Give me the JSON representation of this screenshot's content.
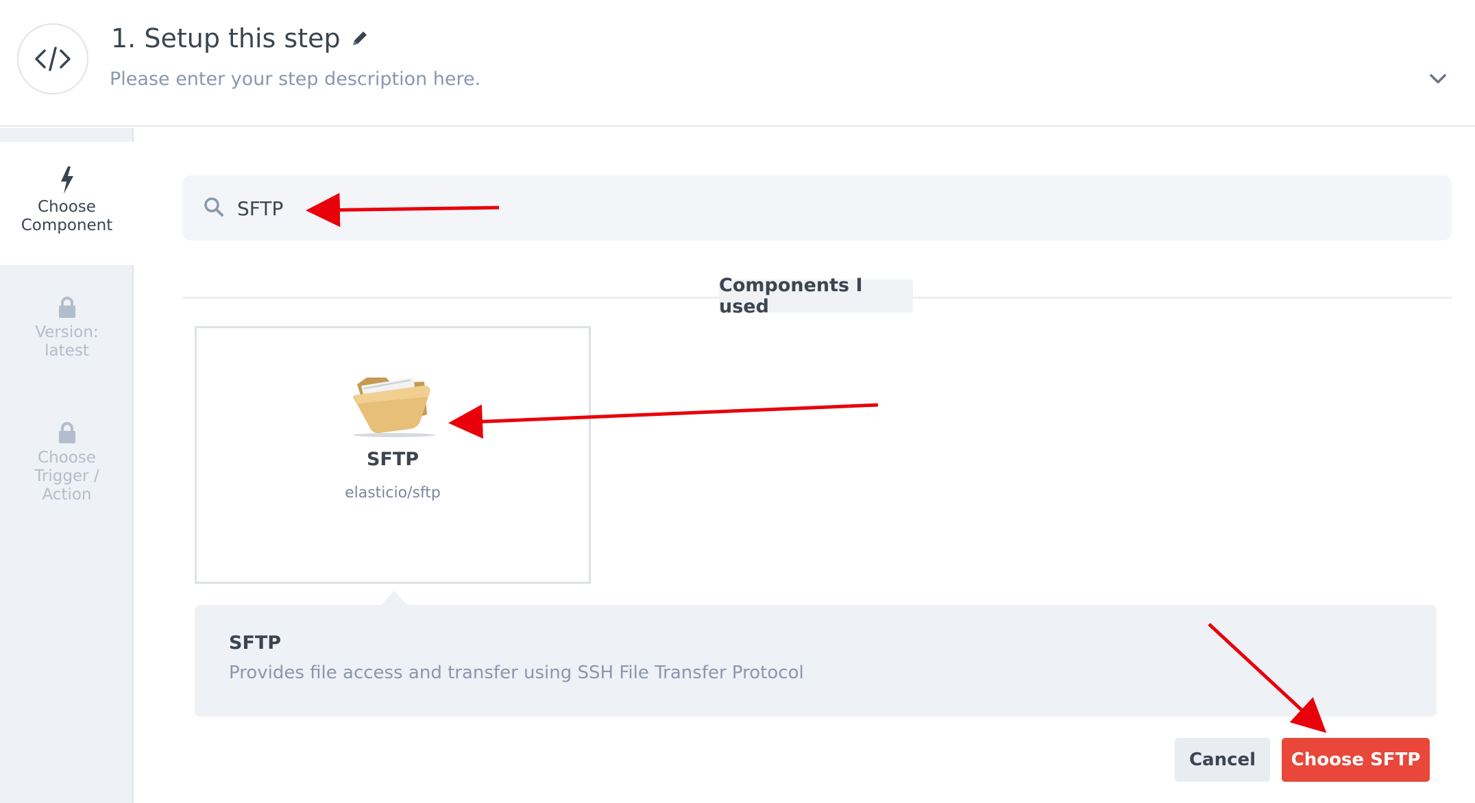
{
  "header": {
    "title": "1. Setup this step",
    "description": "Please enter your step description here.",
    "step_icon": "code-icon",
    "edit_icon": "pencil-icon",
    "collapse_icon": "chevron-down-icon"
  },
  "sidebar": {
    "items": [
      {
        "label_line1": "Choose",
        "label_line2": "Component",
        "icon": "lightning-icon",
        "state": "active"
      },
      {
        "label_line1": "Version:",
        "label_line2": "latest",
        "icon": "lock-icon",
        "state": "locked"
      },
      {
        "label_line1": "Choose",
        "label_line2": "Trigger /",
        "label_line3": "Action",
        "icon": "lock-icon",
        "state": "locked"
      }
    ]
  },
  "search": {
    "value": "SFTP",
    "icon": "search-icon"
  },
  "section": {
    "label": "Components I used"
  },
  "components": [
    {
      "name": "SFTP",
      "path": "elasticio/sftp",
      "icon": "folder-icon"
    }
  ],
  "selected": {
    "title": "SFTP",
    "description": "Provides file access and transfer using SSH File Transfer Protocol"
  },
  "buttons": {
    "cancel_label": "Cancel",
    "choose_label": "Choose SFTP"
  },
  "colors": {
    "accent": "#e8473a",
    "annotation_arrow": "#e8000b",
    "sidebar_bg": "#eef1f5",
    "muted_text": "#8a97ad"
  }
}
